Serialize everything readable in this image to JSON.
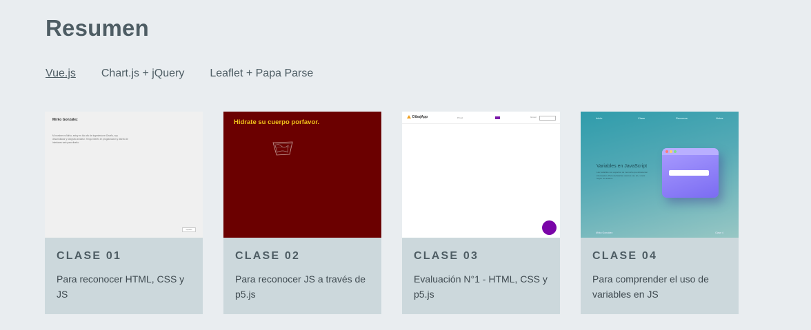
{
  "page": {
    "title": "Resumen"
  },
  "tabs": [
    {
      "label": "Vue.js",
      "active": true
    },
    {
      "label": "Chart.js + jQuery",
      "active": false
    },
    {
      "label": "Leaflet + Papa Parse",
      "active": false
    }
  ],
  "cards": [
    {
      "clase": "CLASE 01",
      "desc": "Para reconocer HTML, CSS y JS",
      "thumb": {
        "name": "Mirko González",
        "text": "Mi nombre es Mirko, estoy en 4to año de Ingeniería en Diseño, soy desarrollador y fotógrafo amateur. Tengo interés en programación y diseño de interfaces web para diseño.",
        "button": "español"
      }
    },
    {
      "clase": "CLASE 02",
      "desc": "Para reconocer JS a través de p5.js",
      "thumb": {
        "headline": "Hidrate su cuerpo porfavor."
      }
    },
    {
      "clase": "CLASE 03",
      "desc": "Evaluación N°1 - HTML, CSS y p5.js",
      "thumb": {
        "logo": "DibujApp",
        "nav": "Pincel",
        "control": "Grosor"
      }
    },
    {
      "clase": "CLASE 04",
      "desc": "Para comprender el uso de variables en JS",
      "thumb": {
        "nav": [
          "Inicio",
          "Clase",
          "Recursos",
          "Notas"
        ],
        "heading": "Variables en JavaScript",
        "text": "Las variables son espacios de memoria que almacenan información. Para declararlas usamos var, let y const según su alcance.",
        "footer_left": "Mirko González",
        "footer_right": "Clase 4"
      }
    }
  ],
  "colors": {
    "background": "#e9edf0",
    "card": "#ccd8dc",
    "heading": "#4e5d64",
    "clase2_bg": "#6b0000",
    "clase2_text": "#f1c21b",
    "clase3_accent": "#7a05a8"
  }
}
